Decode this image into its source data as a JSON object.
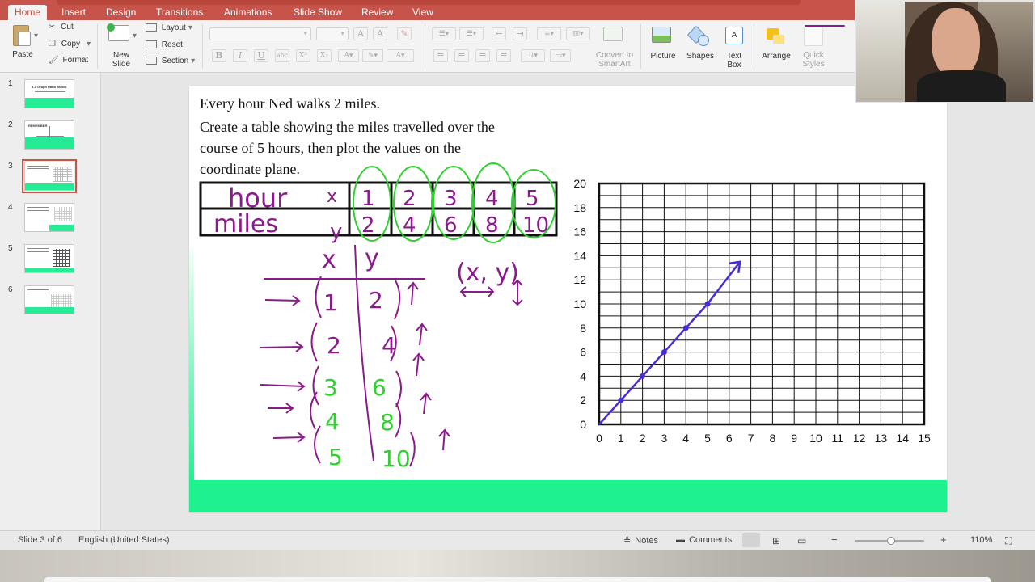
{
  "ribbon": {
    "tabs": [
      {
        "label": "Home",
        "active": true
      },
      {
        "label": "Insert"
      },
      {
        "label": "Design"
      },
      {
        "label": "Transitions"
      },
      {
        "label": "Animations"
      },
      {
        "label": "Slide Show"
      },
      {
        "label": "Review"
      },
      {
        "label": "View"
      }
    ],
    "paste": "Paste",
    "cut": "Cut",
    "copy": "Copy",
    "format": "Format",
    "new_slide_1": "New",
    "new_slide_2": "Slide",
    "layout": "Layout",
    "reset": "Reset",
    "section": "Section",
    "convert_1": "Convert to",
    "convert_2": "SmartArt",
    "picture": "Picture",
    "shapes": "Shapes",
    "textbox_1": "Text",
    "textbox_2": "Box",
    "arrange": "Arrange",
    "quick_1": "Quick",
    "quick_2": "Styles"
  },
  "thumbnails": [
    {
      "num": "1",
      "title": "1.5 Graph Ratio Tables"
    },
    {
      "num": "2",
      "title": "REMEMBER"
    },
    {
      "num": "3",
      "title": "",
      "selected": true
    },
    {
      "num": "4",
      "title": ""
    },
    {
      "num": "5",
      "title": ""
    },
    {
      "num": "6",
      "title": ""
    }
  ],
  "slide": {
    "line1": "Every hour Ned walks 2 miles.",
    "line2": "Create a table showing the miles travelled over the",
    "line3": "course of 5 hours, then plot the values on the",
    "line4": "coordinate plane.",
    "table": {
      "row1_label": "hour",
      "row1_var": "x",
      "row1_values": [
        "1",
        "2",
        "3",
        "4",
        "5"
      ],
      "row2_label": "miles",
      "row2_var": "y",
      "row2_values": [
        "2",
        "4",
        "6",
        "8",
        "10"
      ]
    },
    "tchart": {
      "x_header": "x",
      "y_header": "y",
      "x_values": [
        "1",
        "2",
        "3",
        "4",
        "5"
      ],
      "y_values": [
        "2",
        "4",
        "6",
        "8",
        "10"
      ]
    },
    "pair_label": "(x, y)"
  },
  "chart_data": {
    "type": "line",
    "x": [
      0,
      1,
      2,
      3,
      4,
      5,
      6.5
    ],
    "y": [
      0,
      2,
      4,
      6,
      8,
      10,
      13.5
    ],
    "xlim": [
      0,
      15
    ],
    "ylim": [
      0,
      20
    ],
    "x_ticks": [
      "0",
      "1",
      "2",
      "3",
      "4",
      "5",
      "6",
      "7",
      "8",
      "9",
      "10",
      "11",
      "12",
      "13",
      "14",
      "15"
    ],
    "y_ticks": [
      "0",
      "2",
      "4",
      "6",
      "8",
      "10",
      "12",
      "14",
      "16",
      "18",
      "20"
    ],
    "grid": true,
    "ink_color": "#4a2bd6"
  },
  "status": {
    "slide_info": "Slide 3 of 6",
    "language": "English (United States)",
    "notes": "Notes",
    "comments": "Comments",
    "zoom": "110%"
  },
  "colors": {
    "accent": "#c6544a",
    "slide_green": "#1ef28f",
    "ink_purple": "#8b1a8b",
    "ink_green": "#2ed12e",
    "ink_blue": "#4a2bd6"
  }
}
